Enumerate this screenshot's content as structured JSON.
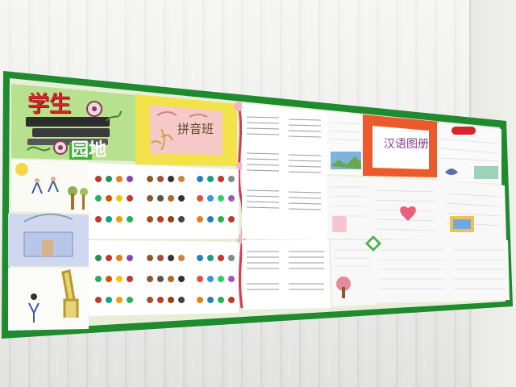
{
  "board": {
    "frame_color": "#1f8a2e",
    "backing_color": "#e6f0d6"
  },
  "header_banner": {
    "line1": "学生",
    "line2": "园地",
    "accent": "#d8232a",
    "panel_color": "#b7e08f"
  },
  "pinyin_card": {
    "title": "拼音班",
    "frame_color": "#f4e24a",
    "card_color": "#f7c9c9"
  },
  "hanyu_card": {
    "title": "汉语图册",
    "frame_color": "#ec5a2b"
  }
}
